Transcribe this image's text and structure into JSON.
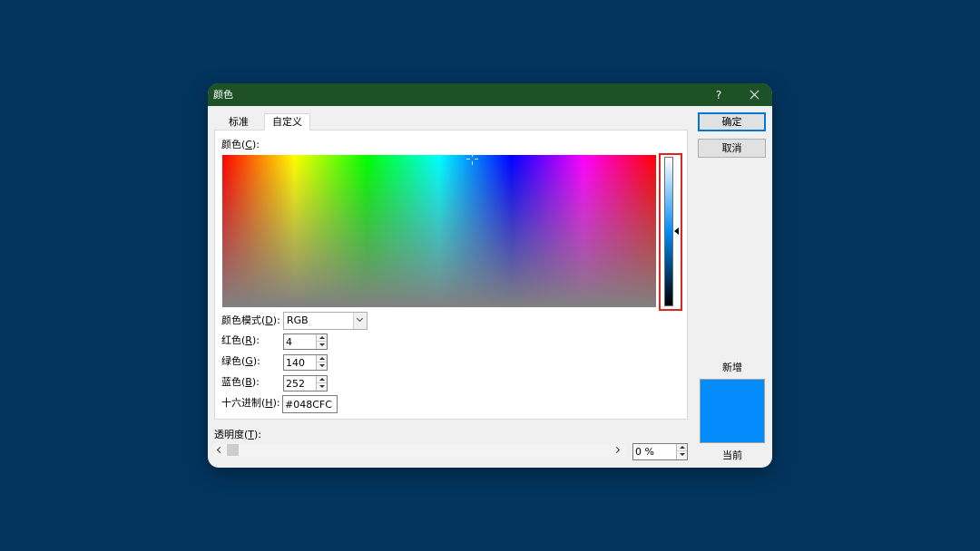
{
  "window": {
    "title": "颜色",
    "help_label": "?"
  },
  "icons": {
    "help": "question-mark-icon",
    "close": "close-icon",
    "dropdown": "chevron-down-icon",
    "spin_up": "triangle-up-icon",
    "spin_down": "triangle-down-icon",
    "scroll_left": "chevron-left-icon",
    "scroll_right": "chevron-right-icon",
    "luminance_pointer": "triangle-left-icon",
    "picker": "crosshair-icon"
  },
  "tabs": [
    {
      "label": "标准",
      "selected": false
    },
    {
      "label": "自定义",
      "selected": true
    }
  ],
  "buttons": {
    "ok": "确定",
    "cancel": "取消"
  },
  "custom": {
    "color_label": {
      "pre": "颜色(",
      "key": "C",
      "post": "):"
    },
    "color_model": {
      "label": {
        "pre": "颜色模式(",
        "key": "D",
        "post": "):"
      },
      "value": "RGB"
    },
    "red": {
      "label": {
        "pre": "红色(",
        "key": "R",
        "post": "):"
      },
      "value": "4"
    },
    "green": {
      "label": {
        "pre": "绿色(",
        "key": "G",
        "post": "):"
      },
      "value": "140"
    },
    "blue": {
      "label": {
        "pre": "蓝色(",
        "key": "B",
        "post": "):"
      },
      "value": "252"
    },
    "hex": {
      "label": {
        "pre": "十六进制(",
        "key": "H",
        "post": "):"
      },
      "value": "#048CFC"
    }
  },
  "transparency": {
    "label": {
      "pre": "透明度(",
      "key": "T",
      "post": "):"
    },
    "value": "0 %",
    "percent": 0
  },
  "preview": {
    "new_label": "新增",
    "current_label": "当前",
    "new_color": "#048CFC",
    "current_color": "#048CFC"
  },
  "colors": {
    "page_background": "#03345e",
    "title_bar": "#1e5226",
    "highlight_border": "#e3231f",
    "default_button_border": "#0078d7"
  }
}
